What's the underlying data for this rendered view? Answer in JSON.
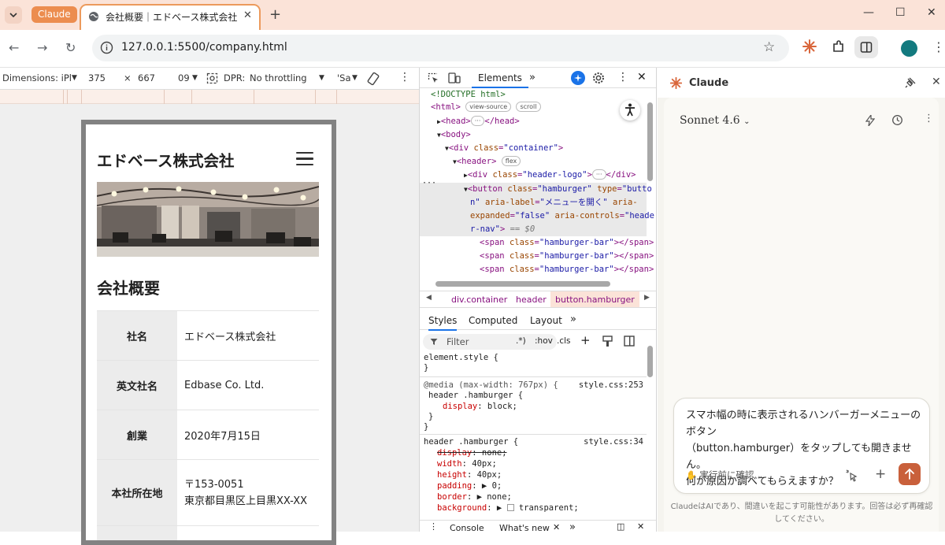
{
  "browser": {
    "tab_group": "Claude",
    "active_tab_title": "会社概要｜エドベース株式会社",
    "url": "127.0.0.1:5500/company.html"
  },
  "device_toolbar": {
    "dimensions_label": "Dimensions: iPl",
    "width": "375",
    "times": "×",
    "height": "667",
    "zoom": "09",
    "dpr_label": "DPR:",
    "throttling": "No throttling",
    "extra": "'Sa"
  },
  "site": {
    "logo": "エドベース株式会社",
    "heading": "会社概要",
    "table": [
      {
        "label": "社名",
        "value": "エドベース株式会社"
      },
      {
        "label": "英文社名",
        "value": "Edbase Co. Ltd."
      },
      {
        "label": "創業",
        "value": "2020年7月15日"
      },
      {
        "label": "本社所在地",
        "value": "〒153-0051",
        "value2": "東京都目黒区上目黒XX-XX"
      }
    ]
  },
  "devtools": {
    "active_tab": "Elements",
    "dom": {
      "doctype": "<!DOCTYPE html>",
      "view_source": "view-source",
      "scroll": "scroll",
      "flex": "flex",
      "eq": "== $0"
    },
    "breadcrumbs": [
      "div.container",
      "header",
      "button.hamburger"
    ],
    "subtabs": [
      "Styles",
      "Computed",
      "Layout"
    ],
    "filter_placeholder": "Filter",
    "filter_tools": [
      ".*)",
      ":hov",
      ".cls"
    ],
    "styles": {
      "element_style": "element.style {",
      "media": "@media (max-width: 767px) {",
      "selector": "header .hamburger {",
      "src1": "style.css:253",
      "src2": "style.css:34"
    },
    "drawer": [
      "Console",
      "What's new"
    ]
  },
  "claude": {
    "title": "Claude",
    "model": "Sonnet 4.6",
    "prompt_line1": "スマホ幅の時に表示されるハンバーガーメニューのボタン",
    "prompt_line2": "（button.hamburger）をタップしても開きません。",
    "prompt_line3": "何が原因か調べてもらえますか？",
    "confirm_label": "実行前に確認",
    "disclaimer_line1": "ClaudeはAIであり、間違いを起こす可能性があります。回答は必ず再確認",
    "disclaimer_line2": "してください。"
  },
  "colors": {
    "accent_orange": "#ec8d4f",
    "send_button": "#c9603b",
    "devtools_blue": "#1a73e8"
  }
}
